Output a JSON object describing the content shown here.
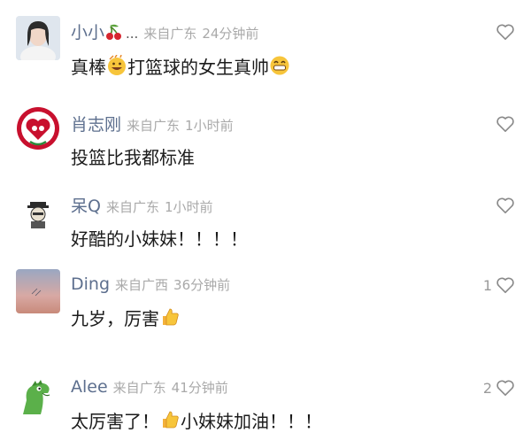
{
  "comments": [
    {
      "username": "小小",
      "username_suffix": "...",
      "location": "来自广东",
      "time": "24分钟前",
      "body_parts": [
        "真棒",
        "打篮球的女生真帅",
        ""
      ],
      "likes": ""
    },
    {
      "username": "肖志刚",
      "location": "来自广东",
      "time": "1小时前",
      "body": "投篮比我都标准",
      "likes": ""
    },
    {
      "username": "呆Q",
      "location": "来自广东",
      "time": "1小时前",
      "body": "好酷的小妹妹！！！！",
      "likes": ""
    },
    {
      "username": "Ding",
      "location": "来自广西",
      "time": "36分钟前",
      "body": "九岁，厉害",
      "likes": "1"
    },
    {
      "username": "Alee",
      "location": "来自广东",
      "time": "41分钟前",
      "body_parts": [
        "太厉害了！",
        "小妹妹加油！！！"
      ],
      "likes": "2"
    }
  ],
  "icons": {
    "like": "heart-outline-icon",
    "cherry": "cherry-icon",
    "grin": "grinning-face-icon",
    "thumbs_up": "thumbs-up-icon"
  },
  "colors": {
    "username": "#5d6f8e",
    "meta": "#a9a9a9",
    "text": "#1b1b1b"
  }
}
